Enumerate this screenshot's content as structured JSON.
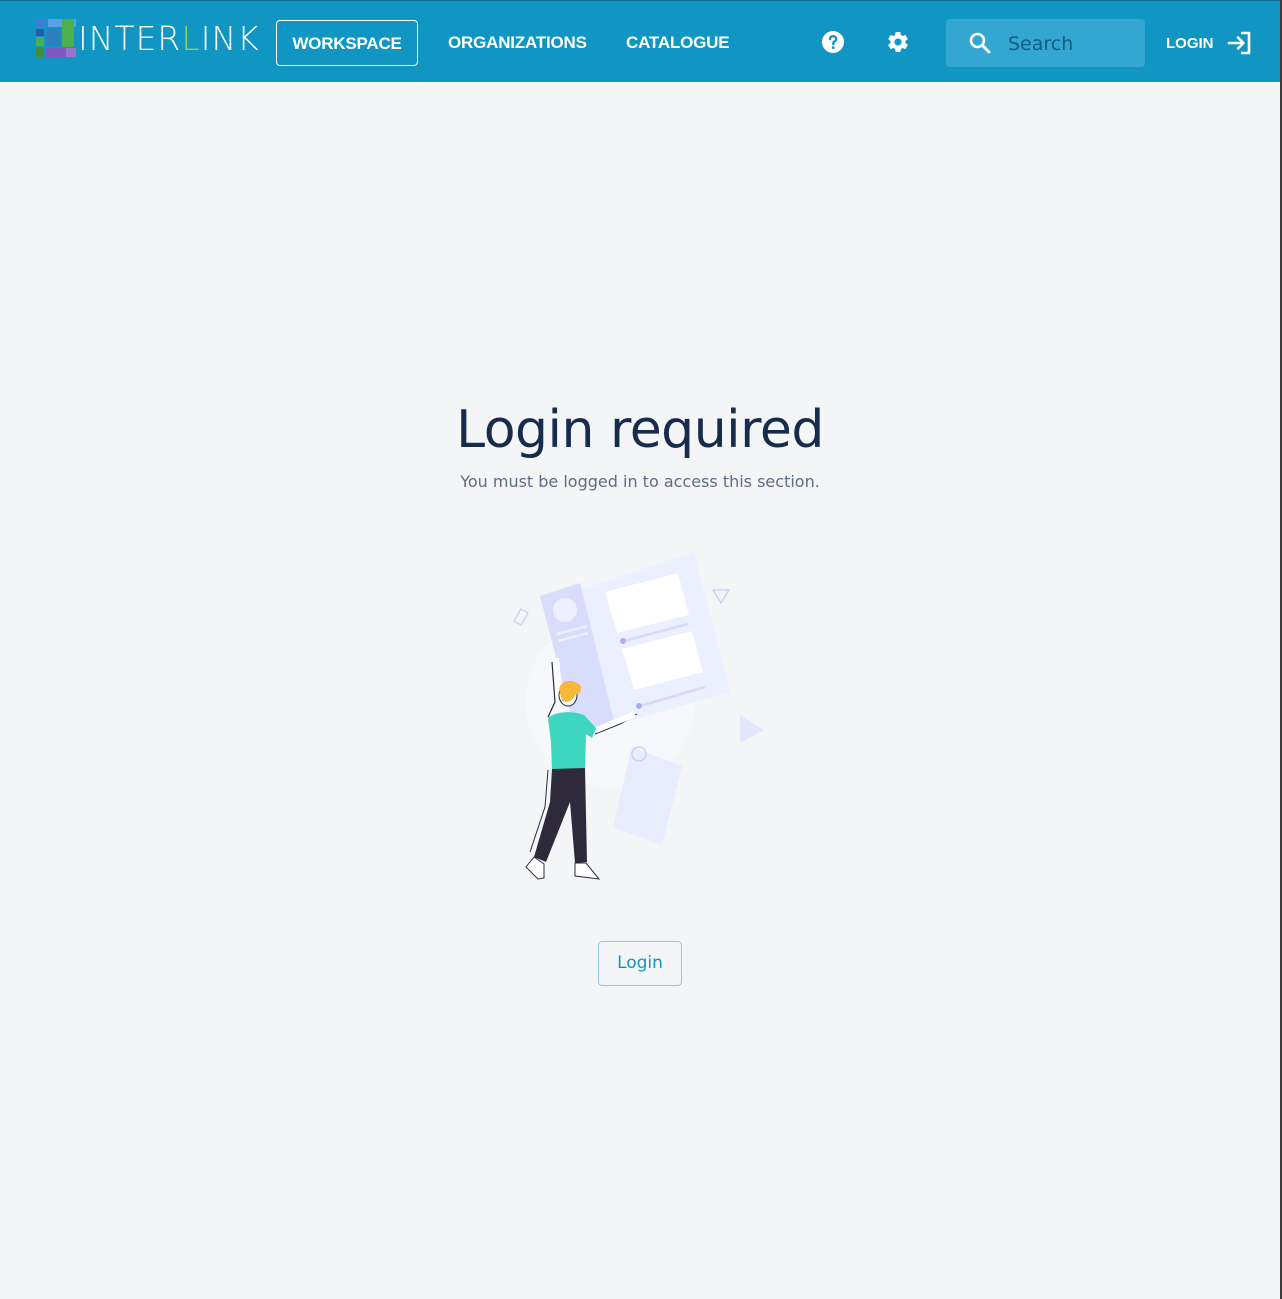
{
  "app": {
    "brand": "INTERLINK",
    "brand_prefix": "INTER",
    "brand_accent": "L",
    "brand_suffix": "INK",
    "brand_color": "#1196c4"
  },
  "nav": {
    "items": [
      {
        "label": "WORKSPACE",
        "active": true
      },
      {
        "label": "ORGANIZATIONS",
        "active": false
      },
      {
        "label": "CATALOGUE",
        "active": false
      }
    ],
    "help_icon": "help-circle-icon",
    "settings_icon": "gear-icon",
    "search": {
      "placeholder": "Search",
      "value": "",
      "icon": "search-icon"
    },
    "login_label": "LOGIN",
    "login_icon": "login-arrow-icon"
  },
  "main": {
    "title": "Login required",
    "subtitle": "You must be logged in to access this section.",
    "button_label": "Login",
    "illustration": "person-holding-document-illustration"
  },
  "colors": {
    "title": "#172b4d",
    "subtitle": "#5e6c84",
    "accent": "#1196c4",
    "background": "#f4f5f7"
  }
}
